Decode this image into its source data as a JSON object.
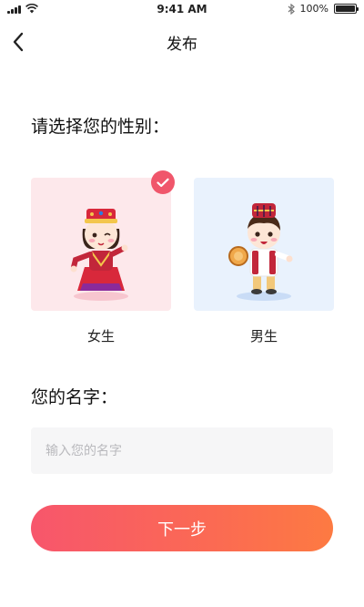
{
  "status_bar": {
    "time": "9:41 AM",
    "battery_text": "100%",
    "battery_level": 1.0,
    "icons": [
      "signal-icon",
      "wifi-icon",
      "bluetooth-icon",
      "battery-icon"
    ]
  },
  "nav": {
    "title": "发布",
    "back_icon": "chevron-left-icon"
  },
  "gender": {
    "prompt": "请选择您的性别：",
    "selected": "female",
    "options": [
      {
        "id": "female",
        "label": "女生",
        "card_color": "#fde8eb"
      },
      {
        "id": "male",
        "label": "男生",
        "card_color": "#e9f2fd"
      }
    ],
    "check_icon": "checkmark-icon"
  },
  "name": {
    "prompt": "您的名字：",
    "value": "",
    "placeholder": "输入您的名字"
  },
  "actions": {
    "next_label": "下一步"
  },
  "colors": {
    "accent": "#f0566b",
    "button_gradient_start": "#f7566c",
    "button_gradient_end": "#fd7a42"
  }
}
